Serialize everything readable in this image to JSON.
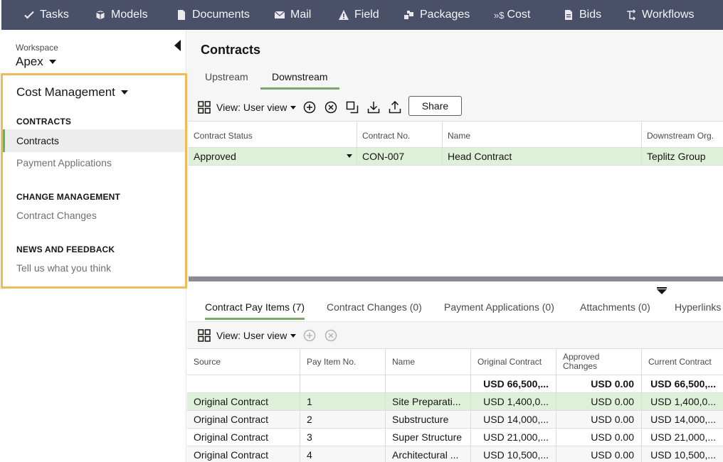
{
  "nav": {
    "items": [
      {
        "label": "Tasks",
        "icon": "check-icon"
      },
      {
        "label": "Models",
        "icon": "cube-icon"
      },
      {
        "label": "Documents",
        "icon": "document-icon"
      },
      {
        "label": "Mail",
        "icon": "envelope-icon"
      },
      {
        "label": "Field",
        "icon": "warning-icon"
      },
      {
        "label": "Packages",
        "icon": "packages-icon"
      },
      {
        "label": "Cost",
        "icon": "cost-icon",
        "prefix": "»$"
      },
      {
        "label": "Bids",
        "icon": "bids-icon"
      },
      {
        "label": "Workflows",
        "icon": "workflow-icon"
      }
    ]
  },
  "sidebar": {
    "workspace_label": "Workspace",
    "workspace_value": "Apex",
    "module": "Cost Management",
    "sections": [
      {
        "heading": "CONTRACTS",
        "links": [
          "Contracts",
          "Payment Applications"
        ]
      },
      {
        "heading": "CHANGE MANAGEMENT",
        "links": [
          "Contract Changes"
        ]
      },
      {
        "heading": "NEWS AND FEEDBACK",
        "links": [
          "Tell us what you think"
        ]
      }
    ]
  },
  "main": {
    "title": "Contracts",
    "tabs": [
      "Upstream",
      "Downstream"
    ],
    "active_tab": "Downstream",
    "toolbar": {
      "view_label": "View: User view",
      "share_label": "Share"
    },
    "grid": {
      "columns": [
        "Contract Status",
        "Contract No.",
        "Name",
        "Downstream Org."
      ],
      "rows": [
        {
          "status": "Approved",
          "number": "CON-007",
          "name": "Head Contract",
          "org": "Teplitz Group"
        }
      ]
    }
  },
  "detail": {
    "tabs": [
      "Contract Pay Items (7)",
      "Contract Changes (0)",
      "Payment Applications (0)",
      "Attachments (0)",
      "Hyperlinks"
    ],
    "active_tab": "Contract Pay Items (7)",
    "toolbar": {
      "view_label": "View: User view"
    },
    "grid": {
      "columns": [
        "Source",
        "Pay Item No.",
        "Name",
        "Original Contract",
        "Approved Changes",
        "Current Contract"
      ],
      "totals": {
        "original": "USD 66,500,...",
        "approved": "USD 0.00",
        "current": "USD 66,500,..."
      },
      "rows": [
        {
          "source": "Original Contract",
          "no": "1",
          "name": "Site Preparati...",
          "original": "USD 1,400,0...",
          "approved": "USD 0.00",
          "current": "USD 1,400,0..."
        },
        {
          "source": "Original Contract",
          "no": "2",
          "name": "Substructure",
          "original": "USD 14,000,...",
          "approved": "USD 0.00",
          "current": "USD 14,000,..."
        },
        {
          "source": "Original Contract",
          "no": "3",
          "name": "Super Structure",
          "original": "USD 21,000,...",
          "approved": "USD 0.00",
          "current": "USD 21,000,..."
        },
        {
          "source": "Original Contract",
          "no": "4",
          "name": "Architectural ...",
          "original": "USD 10,500,...",
          "approved": "USD 0.00",
          "current": "USD 10,500,..."
        }
      ]
    }
  },
  "colors": {
    "nav_bg": "#4b5069",
    "accent": "#7aa869",
    "highlight_border": "#f0b95a",
    "selected_row": "#dff0d8"
  }
}
